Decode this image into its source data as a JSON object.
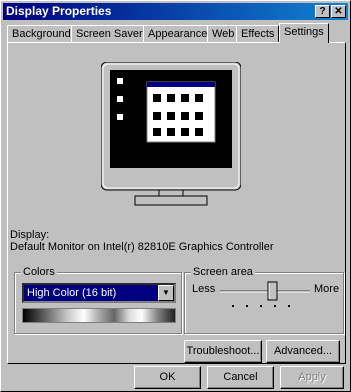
{
  "window": {
    "title": "Display Properties",
    "help_btn": "?",
    "close_btn": "✕"
  },
  "tabs": [
    {
      "label": "Background"
    },
    {
      "label": "Screen Saver"
    },
    {
      "label": "Appearance"
    },
    {
      "label": "Web"
    },
    {
      "label": "Effects"
    },
    {
      "label": "Settings"
    }
  ],
  "display": {
    "caption": "Display:",
    "value": "Default Monitor on Intel(r) 82810E Graphics Controller"
  },
  "colors": {
    "title": "Colors",
    "selected": "High Color (16 bit)"
  },
  "screen_area": {
    "title": "Screen area",
    "less": "Less",
    "more": "More"
  },
  "buttons": {
    "troubleshoot": "Troubleshoot...",
    "advanced": "Advanced...",
    "ok": "OK",
    "cancel": "Cancel",
    "apply": "Apply"
  }
}
